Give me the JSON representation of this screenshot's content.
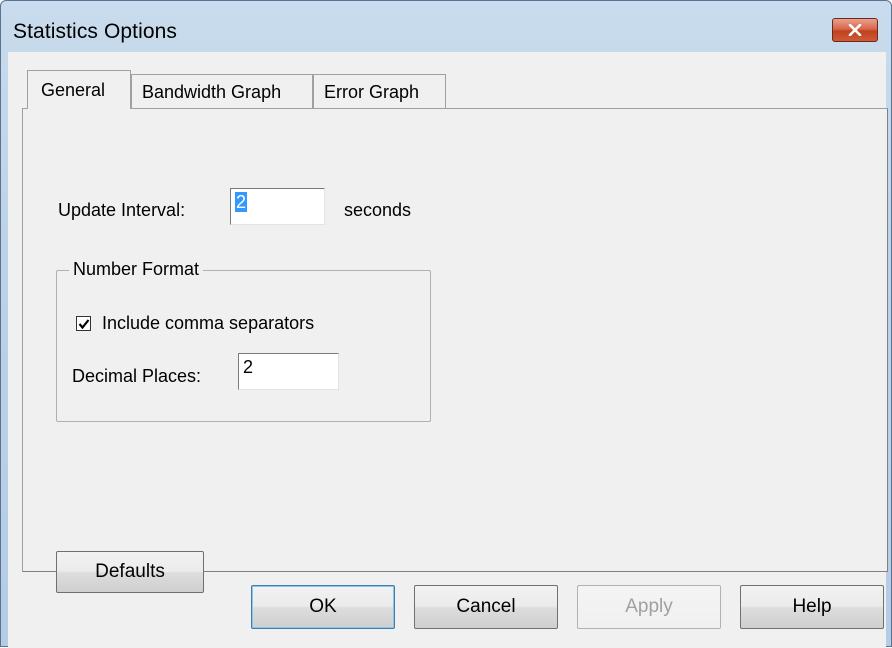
{
  "window": {
    "title": "Statistics Options"
  },
  "tabs": [
    {
      "label": "General",
      "active": true
    },
    {
      "label": "Bandwidth Graph",
      "active": false
    },
    {
      "label": "Error Graph",
      "active": false
    }
  ],
  "general": {
    "update_interval_label": "Update Interval:",
    "update_interval_value": "2",
    "update_interval_unit": "seconds",
    "number_format": {
      "legend": "Number Format",
      "include_commas_label": "Include comma separators",
      "include_commas_checked": true,
      "decimal_places_label": "Decimal Places:",
      "decimal_places_value": "2"
    },
    "defaults_label": "Defaults"
  },
  "buttons": {
    "ok": "OK",
    "cancel": "Cancel",
    "apply": "Apply",
    "help": "Help"
  },
  "colors": {
    "selection": "#3399ff",
    "close_button": "#c2421f",
    "default_button_border": "#3c7fb1"
  }
}
